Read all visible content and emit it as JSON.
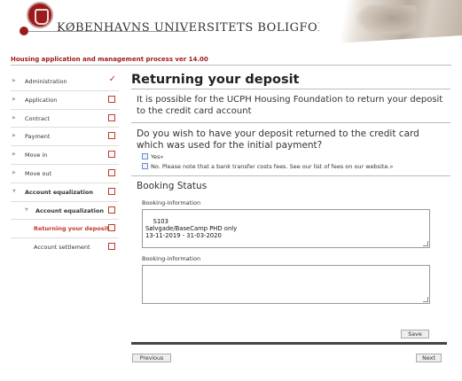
{
  "header": {
    "university_name": "KØBENHAVNS UNIVERSITETS BOLIGFOND"
  },
  "process_title": "Housing application and management process ver 14.00",
  "sidebar": {
    "items": [
      {
        "label": "Administration",
        "status": "check"
      },
      {
        "label": "Application",
        "status": "box"
      },
      {
        "label": "Contract",
        "status": "box"
      },
      {
        "label": "Payment",
        "status": "box"
      },
      {
        "label": "Move in",
        "status": "box"
      },
      {
        "label": "Move out",
        "status": "box"
      },
      {
        "label": "Account equalization",
        "status": "box"
      },
      {
        "label": "Account equalization",
        "status": "box"
      },
      {
        "label": "Returning your deposit",
        "status": "box"
      },
      {
        "label": "Account settlement",
        "status": "box"
      }
    ]
  },
  "main": {
    "title": "Returning your deposit",
    "intro": "It is possible for the UCPH Housing Foundation to return your deposit to the credit card account",
    "question": "Do you wish to have your deposit returned to the credit card which was used for the initial payment?",
    "option_yes": "Yes»",
    "option_no": "No. Please note that a bank transfer costs fees. See our list of fees on our website.»",
    "booking_status_title": "Booking Status",
    "booking_label_1": "Booking-information",
    "booking_value_1": "S103\nSølvgade/BaseCamp PHD only\n13-11-2019 - 31-03-2020",
    "booking_label_2": "Booking-information",
    "booking_value_2": "",
    "save_label": "Save",
    "previous_label": "Previous",
    "next_label": "Next"
  },
  "colors": {
    "accent": "#9b1b1b",
    "status_red": "#c0392b"
  }
}
